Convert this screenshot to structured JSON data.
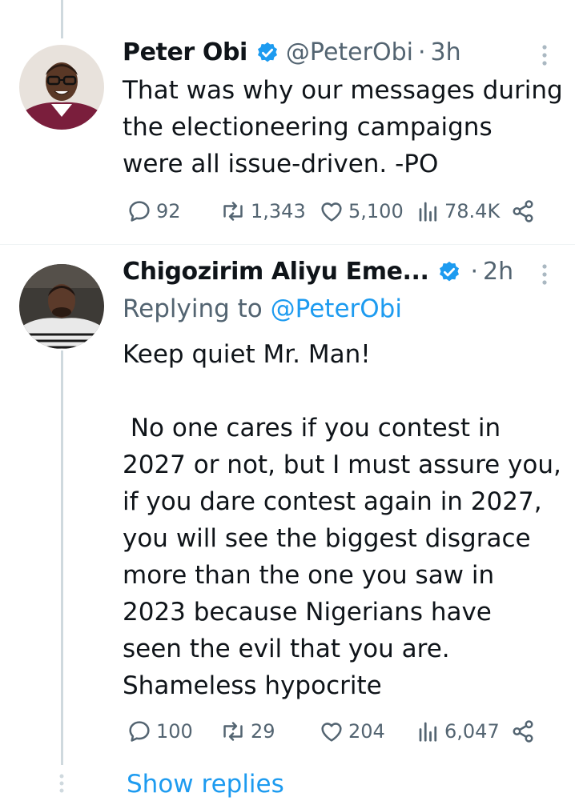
{
  "tweets": [
    {
      "name": "Peter Obi",
      "handle": "@PeterObi",
      "time": "3h",
      "text": "That was why our messages during\nthe electioneering campaigns\nwere all issue-driven. -PO",
      "replies": "92",
      "retweets": "1,343",
      "likes": "5,100",
      "views": "78.4K"
    },
    {
      "name": "Chigozirim Aliyu Eme...",
      "time": "2h",
      "replying_prefix": "Replying to ",
      "replying_handle": "@PeterObi",
      "text": "Keep quiet Mr. Man!\n\n No one cares if you contest in\n2027 or not, but I must assure you,\nif you dare contest again in 2027,\nyou will see the biggest disgrace\nmore than the one you saw in\n2023 because Nigerians have\nseen the evil that you are.\nShameless hypocrite",
      "replies": "100",
      "retweets": "29",
      "likes": "204",
      "views": "6,047"
    }
  ],
  "show_replies": "Show replies",
  "colors": {
    "accent": "#1d9bf0",
    "secondary": "#536471",
    "line": "#cfd9de"
  }
}
